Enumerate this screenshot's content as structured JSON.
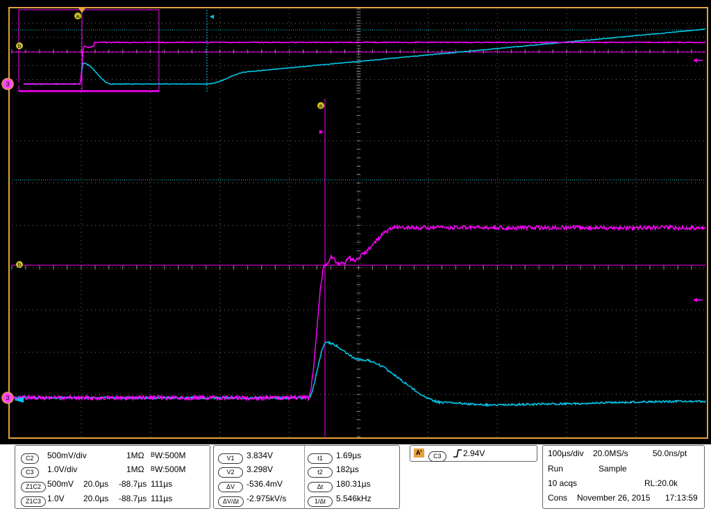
{
  "channels": {
    "ch2": {
      "label": "C2",
      "scale": "500mV/div",
      "impedance": "1MΩ",
      "bw_prefix": "B",
      "bw_suffix": "W",
      "bw_value": ":500M",
      "color": "#ff00ff"
    },
    "ch3": {
      "label": "C3",
      "scale": "1.0V/div",
      "impedance": "1MΩ",
      "bw_prefix": "B",
      "bw_suffix": "W",
      "bw_value": ":500M",
      "color": "#00ccee"
    }
  },
  "zoom": [
    {
      "label": "Z1C2",
      "scale": "500mV",
      "time_div": "20.0µs",
      "offset": "-88.7µs",
      "pos": "111µs"
    },
    {
      "label": "Z1C3",
      "scale": "1.0V",
      "time_div": "20.0µs",
      "offset": "-88.7µs",
      "pos": "111µs"
    }
  ],
  "cursors": {
    "v1": {
      "label": "V1",
      "value": "3.834V"
    },
    "v2": {
      "label": "V2",
      "value": "3.298V"
    },
    "dv": {
      "label": "ΔV",
      "value": "-536.4mV"
    },
    "dvdt": {
      "label": "ΔV/Δt",
      "value": "-2.975kV/s"
    },
    "t1": {
      "label": "t1",
      "value": "1.69µs"
    },
    "t2": {
      "label": "t2",
      "value": "182µs"
    },
    "dt": {
      "label": "Δt",
      "value": "180.31µs"
    },
    "inv_dt": {
      "label": "1/Δt",
      "value": "5.546kHz"
    }
  },
  "trigger": {
    "mode": "A'",
    "source": "C3",
    "slope_icon": "rising-edge",
    "level": "2.94V"
  },
  "acquisition": {
    "time_div": "100µs/div",
    "sample_rate": "20.0MS/s",
    "resolution": "50.0ns/pt",
    "state": "Run",
    "mode": "Sample",
    "acqs": "10 acqs",
    "record_length": "RL:20.0k",
    "cons": "Cons",
    "date": "November 26, 2015",
    "time": "17:13:59"
  },
  "markers": {
    "a": "a",
    "b": "b",
    "ch3": "3"
  },
  "colors": {
    "ch2": "#ff00ff",
    "ch3": "#00ccee",
    "frame": "#e8a040",
    "grid": "#8a8a8a"
  }
}
